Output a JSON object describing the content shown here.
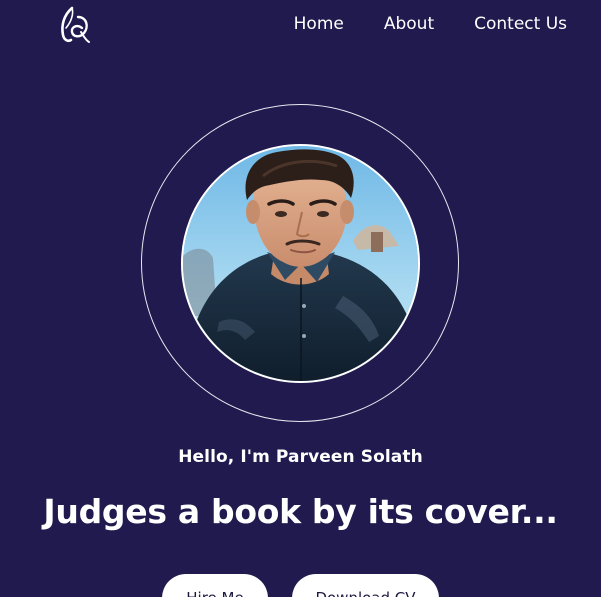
{
  "header": {
    "logo_icon": "stylized-initials-logo",
    "nav": [
      {
        "label": "Home"
      },
      {
        "label": "About"
      },
      {
        "label": "Contect Us"
      }
    ]
  },
  "hero": {
    "avatar_icon": "profile-photo",
    "greeting": "Hello, I'm Parveen Solath",
    "headline": "Judges a book by its cover...",
    "buttons": {
      "hire": "Hire Me",
      "cv": "Download CV"
    }
  },
  "colors": {
    "background": "#201a4e",
    "text": "#ffffff",
    "button_bg": "#ffffff",
    "button_text": "#1b1840"
  }
}
